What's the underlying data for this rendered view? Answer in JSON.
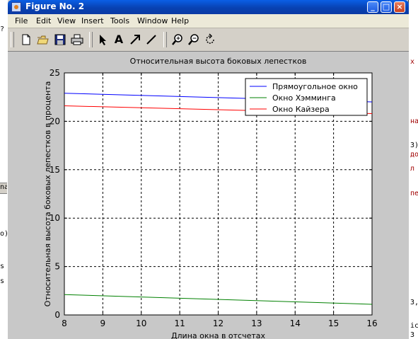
{
  "window": {
    "title": "Figure No. 2",
    "controls": [
      "_",
      "□",
      "×"
    ]
  },
  "menubar": {
    "items": [
      "File",
      "Edit",
      "View",
      "Insert",
      "Tools",
      "Window",
      "Help"
    ]
  },
  "toolbar": {
    "buttons": [
      "new-figure-icon",
      "open-file-icon",
      "save-icon",
      "print-icon",
      "select-arrow-icon",
      "insert-text-icon",
      "insert-arrow-icon",
      "insert-line-icon",
      "zoom-in-icon",
      "zoom-out-icon",
      "rotate-icon"
    ],
    "text_tool_glyph": "A"
  },
  "background": {
    "left_fragments": [
      "?",
      "na",
      "o)",
      "s",
      "s"
    ],
    "right_fragments": [
      "x",
      "на",
      "3)",
      "до",
      "л",
      "пе",
      "3,",
      "ic",
      "3"
    ]
  },
  "chart_data": {
    "type": "line",
    "title": "Относительная высота боковых лепестков",
    "xlabel": "Длина окна в отсчетах",
    "ylabel": "Относительная высота боковых лепестков в процента",
    "xlim": [
      8,
      16
    ],
    "ylim": [
      0,
      25
    ],
    "xticks": [
      8,
      9,
      10,
      11,
      12,
      13,
      14,
      15,
      16
    ],
    "yticks": [
      0,
      5,
      10,
      15,
      20,
      25
    ],
    "grid": true,
    "legend_position": "top-right",
    "x": [
      8,
      16
    ],
    "series": [
      {
        "name": "Прямоугольное окно",
        "color": "#0000ff",
        "values": [
          22.9,
          22.0
        ]
      },
      {
        "name": "Окно Хэмминга",
        "color": "#008000",
        "values": [
          2.1,
          1.1
        ]
      },
      {
        "name": "Окно Кайзера",
        "color": "#ff0000",
        "values": [
          21.6,
          20.8
        ]
      }
    ]
  }
}
